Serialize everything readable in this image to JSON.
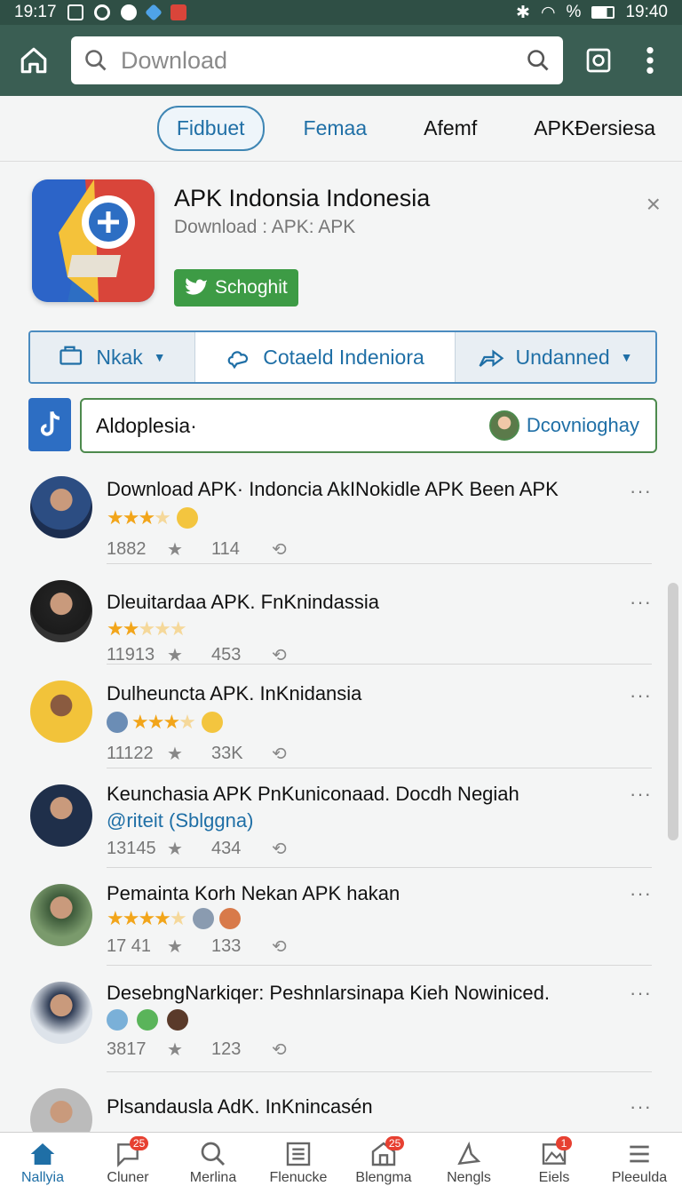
{
  "status_bar": {
    "time_left": "19:17",
    "battery": "%",
    "time_right": "19:40"
  },
  "search": {
    "placeholder": "Download"
  },
  "tabs": [
    "Fidbuet",
    "Femaa",
    "Afemf",
    "APKĐersiesa"
  ],
  "app": {
    "title": "APK Indonsia Indonesia",
    "subtitle": "Download : APK: APK",
    "button_label": "Schoghit",
    "close": "×"
  },
  "segments": [
    "Nkak",
    "Cotaeld Indeniora",
    "Undanned"
  ],
  "row2": {
    "left": "Aldoplesia·",
    "right": "Dcovnioghay"
  },
  "feed": [
    {
      "title": "Download APK· Indoncia AkINokidle APK Been APK",
      "stars": 3,
      "count1": "1882",
      "count2": "114",
      "mention": ""
    },
    {
      "title": "Dleuitardaa APK. FnKnindassia",
      "stars": 2,
      "count1": "11913",
      "count2": "453",
      "mention": ""
    },
    {
      "title": "Dulheuncta APK. InKnidansia",
      "stars": 3,
      "count1": "11122",
      "count2": "33K",
      "mention": ""
    },
    {
      "title": "Keunchasia APK PnKuniconaad. Docdh Negiah",
      "stars": 0,
      "count1": "13145",
      "count2": "434",
      "mention": "@riteit (Sblggna)"
    },
    {
      "title": "Pemainta Korh Nekan APK hakan",
      "stars": 4,
      "count1": "17 41",
      "count2": "133",
      "mention": ""
    },
    {
      "title": "DesebngNarkiqer: Peshnlarsinapa Kieh Nowiniced.",
      "stars": 0,
      "count1": "3817",
      "count2": "123",
      "mention": ""
    },
    {
      "title": "Plsandausla AdK. InKnincasén",
      "stars": 0,
      "count1": "",
      "count2": "",
      "mention": ""
    }
  ],
  "more": "···",
  "bottom_nav": [
    {
      "label": "Nallyia",
      "badge": ""
    },
    {
      "label": "Cluner",
      "badge": "25"
    },
    {
      "label": "Merlina",
      "badge": ""
    },
    {
      "label": "Flenucke",
      "badge": ""
    },
    {
      "label": "Blengma",
      "badge": "25"
    },
    {
      "label": "Nengls",
      "badge": ""
    },
    {
      "label": "Eiels",
      "badge": "1"
    },
    {
      "label": "Pleeulda",
      "badge": ""
    }
  ],
  "colors": {
    "topbar": "#3a5e53",
    "accent": "#1f6fa6",
    "green": "#3d9b45",
    "star": "#f2a51a"
  }
}
